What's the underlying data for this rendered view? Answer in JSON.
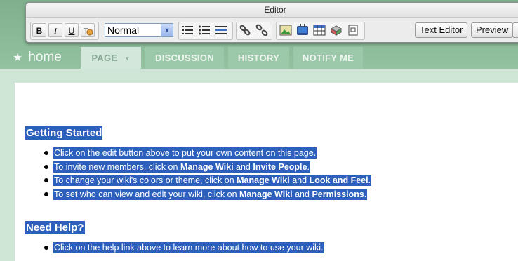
{
  "editor": {
    "title": "Editor",
    "bold": "B",
    "italic": "I",
    "underline": "U",
    "format_select": "Normal",
    "text_editor_button": "Text Editor",
    "preview_button": "Preview"
  },
  "nav": {
    "home": "home",
    "tabs": [
      {
        "label": "PAGE"
      },
      {
        "label": "DISCUSSION"
      },
      {
        "label": "HISTORY"
      },
      {
        "label": "NOTIFY ME"
      }
    ]
  },
  "content": {
    "getting_started": {
      "heading": "Getting Started",
      "items": [
        {
          "parts": [
            "Click on the edit button above to put your own content on this page."
          ]
        },
        {
          "parts": [
            "To invite new members, click on ",
            "Manage Wiki",
            " and ",
            "Invite People",
            "."
          ]
        },
        {
          "parts": [
            "To change your wiki's colors or theme, click on ",
            "Manage Wiki",
            " and ",
            "Look and Feel",
            "."
          ]
        },
        {
          "parts": [
            "To set who can view and edit your wiki, click on ",
            "Manage Wiki",
            " and ",
            "Permissions",
            "."
          ]
        }
      ]
    },
    "need_help": {
      "heading": "Need Help?",
      "items": [
        {
          "parts": [
            "Click on the help link above to learn more about how to use your wiki."
          ]
        }
      ]
    }
  }
}
